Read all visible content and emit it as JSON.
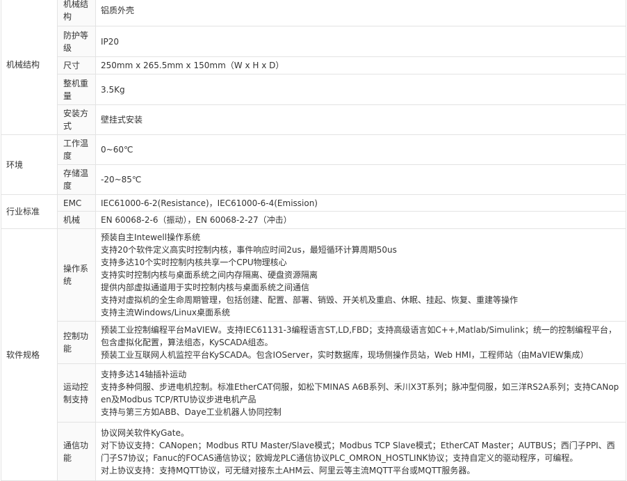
{
  "table": {
    "sections": [
      {
        "category": "机械结构",
        "rows": [
          {
            "label": "机械结构",
            "value": "铝质外壳"
          },
          {
            "label": "防护等级",
            "value": "IP20"
          },
          {
            "label": "尺寸",
            "value": "250mm x 265.5mm x 150mm（W x H x D）"
          },
          {
            "label": "整机重量",
            "value": "3.5Kg"
          },
          {
            "label": "安装方式",
            "value": "壁挂式安装"
          }
        ]
      },
      {
        "category": "环境",
        "rows": [
          {
            "label": "工作温度",
            "value": "0~60℃"
          },
          {
            "label": "存储温度",
            "value": "-20~85℃"
          }
        ]
      },
      {
        "category": "行业标准",
        "rows": [
          {
            "label": "EMC",
            "value": "IEC61000-6-2(Resistance)，IEC61000-6-4(Emission)"
          },
          {
            "label": "机械",
            "value": "EN 60068-2-6（振动），EN 60068-2-27（冲击）"
          }
        ]
      },
      {
        "category": "软件规格",
        "rows": [
          {
            "label": "操作系统",
            "lines": [
              "预装自主Intewell操作系统",
              "支持20个软件定义高实时控制内核，事件响应时间2us，最短循环计算周期50us",
              "支持多达10个实时控制内核共享一个CPU物理核心",
              "支持实时控制内核与桌面系统之间内存隔离、硬盘资源隔离",
              "提供内部虚拟通道用于实时控制内核与桌面系统之间通信",
              "支持对虚拟机的全生命周期管理，包括创建、配置、部署、销毁、开关机及重启、休眠、挂起、恢复、重建等操作",
              "支持主流Windows/Linux桌面系统"
            ]
          },
          {
            "label": "控制功能",
            "lines": [
              "预装工业控制编程平台MaVIEW。支持IEC61131-3编程语言ST,LD,FBD；支持高级语言如C++,Matlab/Simulink；统一的控制编程平台，包含虚拟化配置，算法组态，KySCADA组态。",
              "预装工业互联网人机监控平台KySCADA。包含IOServer，实时数据库，现场侧操作员站，Web HMI，工程师站（由MaVIEW集成）"
            ]
          },
          {
            "label": "运动控制支持",
            "lines": [
              "支持多达14轴插补运动",
              "支持多种伺服、步进电机控制。标准EtherCAT伺服，如松下MINAS A6B系列、禾川X3T系列；脉冲型伺服，如三洋RS2A系列；支持CANopen及Modbus TCP/RTU协议步进电机产品",
              "支持与第三方如ABB、Daye工业机器人协同控制"
            ]
          },
          {
            "label": "通信功能",
            "lines": [
              "协议网关软件KyGate。",
              "对下协议支持：CANopen；Modbus RTU Master/Slave模式；Modbus TCP Slave模式；EtherCAT Master；AUTBUS；西门子PPI、西门子S7协议；Fanuc的FOCAS通信协议；欧姆龙PLC通信协议PLC_OMRON_HOSTLINK协议；支持自定义的驱动程序，可编程。",
              "对上协议支持：支持MQTT协议，可无缝对接东土AHM云、阿里云等主流MQTT平台或MQTT服务器。"
            ]
          }
        ]
      }
    ]
  }
}
